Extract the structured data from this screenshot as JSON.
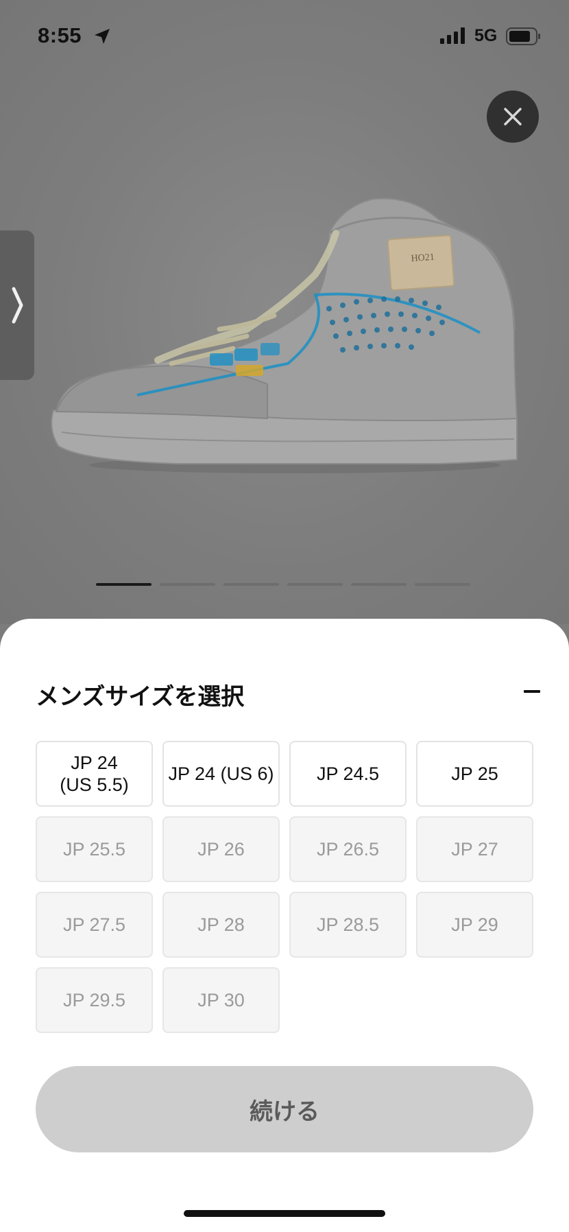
{
  "status_bar": {
    "time": "8:55",
    "network": "5G"
  },
  "product": {
    "image_icon": "sneaker-image",
    "carousel_pages": 6,
    "carousel_active_index": 0
  },
  "sheet": {
    "title": "メンズサイズを選択",
    "sizes": [
      {
        "line1": "JP 24",
        "line2": "(US 5.5)",
        "available": true
      },
      {
        "line1": "JP 24 (US 6)",
        "line2": "",
        "available": true
      },
      {
        "line1": "JP 24.5",
        "line2": "",
        "available": true
      },
      {
        "line1": "JP 25",
        "line2": "",
        "available": true
      },
      {
        "line1": "JP 25.5",
        "line2": "",
        "available": false
      },
      {
        "line1": "JP 26",
        "line2": "",
        "available": false
      },
      {
        "line1": "JP 26.5",
        "line2": "",
        "available": false
      },
      {
        "line1": "JP 27",
        "line2": "",
        "available": false
      },
      {
        "line1": "JP 27.5",
        "line2": "",
        "available": false
      },
      {
        "line1": "JP 28",
        "line2": "",
        "available": false
      },
      {
        "line1": "JP 28.5",
        "line2": "",
        "available": false
      },
      {
        "line1": "JP 29",
        "line2": "",
        "available": false
      },
      {
        "line1": "JP 29.5",
        "line2": "",
        "available": false
      },
      {
        "line1": "JP 30",
        "line2": "",
        "available": false
      }
    ],
    "continue_label": "続ける"
  },
  "colors": {
    "overlay": "#7c7c7c",
    "sheet_bg": "#ffffff",
    "button_disabled": "#cecece",
    "shoe_accent_blue": "#1a8fc4",
    "shoe_accent_yellow": "#d4a72c"
  }
}
